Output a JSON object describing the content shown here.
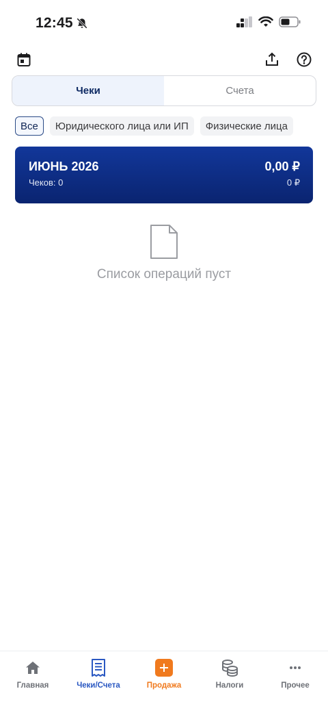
{
  "status_bar": {
    "time": "12:45"
  },
  "tabs": {
    "checks": "Чеки",
    "invoices": "Счета"
  },
  "filters": [
    "Все",
    "Юридического лица или ИП",
    "Физические лица"
  ],
  "period": {
    "title": "ИЮНЬ 2026",
    "total": "0,00 ₽",
    "count_label": "Чеков: 0",
    "secondary_total": "0 ₽"
  },
  "empty_state": {
    "text": "Список операций пуст"
  },
  "bottom_nav": [
    {
      "label": "Главная",
      "icon": "home-icon"
    },
    {
      "label": "Чеки/Счета",
      "icon": "receipt-icon"
    },
    {
      "label": "Продажа",
      "icon": "plus-icon"
    },
    {
      "label": "Налоги",
      "icon": "coins-icon"
    },
    {
      "label": "Прочее",
      "icon": "more-icon"
    }
  ],
  "colors": {
    "accent": "#2a58c2",
    "card": "#0f2f8a",
    "sale": "#f07a1e"
  }
}
